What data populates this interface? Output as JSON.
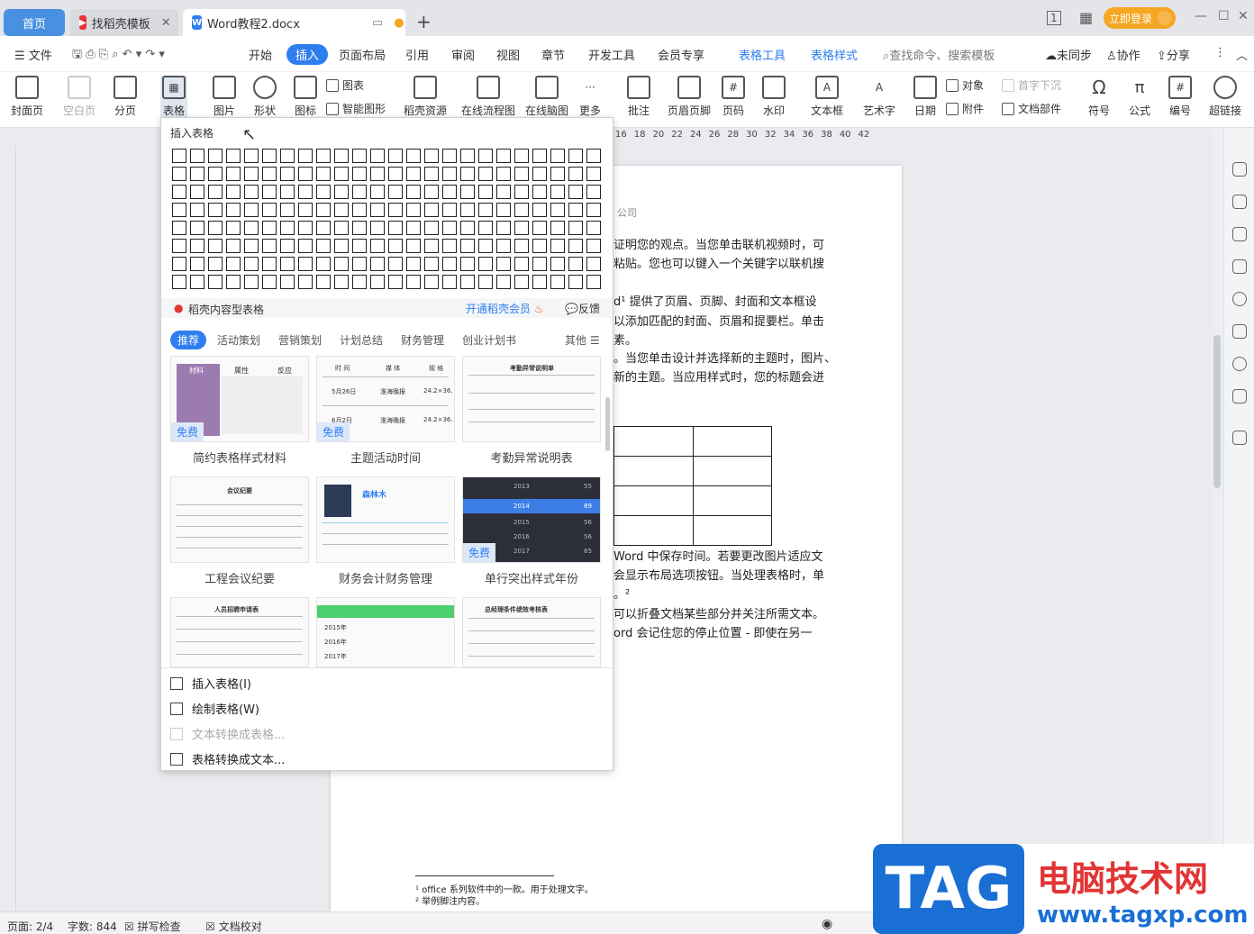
{
  "tabs": {
    "home": "首页",
    "template": "找稻壳模板",
    "document": "Word教程2.docx",
    "add": "+"
  },
  "titlebar": {
    "login": "立即登录"
  },
  "menu": {
    "file": "文件",
    "items": [
      "开始",
      "插入",
      "页面布局",
      "引用",
      "审阅",
      "视图",
      "章节",
      "开发工具",
      "会员专享"
    ],
    "context": [
      "表格工具",
      "表格样式"
    ],
    "search": "查找命令、搜索模板",
    "sync": "未同步",
    "collab": "协作",
    "share": "分享"
  },
  "ribbon": {
    "cover": "封面页",
    "blank": "空白页",
    "pagebreak": "分页",
    "table": "表格",
    "picture": "图片",
    "shape": "形状",
    "icon": "图标",
    "chart": "图表",
    "smartart": "智能图形",
    "docres": "稻壳资源",
    "flow": "在线流程图",
    "mind": "在线脑图",
    "more": "更多",
    "comment": "批注",
    "headerfooter": "页眉页脚",
    "pagenum": "页码",
    "watermark": "水印",
    "textbox": "文本框",
    "wordart": "艺术字",
    "date": "日期",
    "object": "对象",
    "attach": "附件",
    "dropcap": "首字下沉",
    "docpart": "文档部件",
    "symbol": "符号",
    "formula": "公式",
    "numbering": "编号",
    "hyperlink": "超链接"
  },
  "ruler": {
    "ticks": [
      "16",
      "18",
      "20",
      "22",
      "24",
      "26",
      "28",
      "30",
      "32",
      "34",
      "36",
      "38",
      "40",
      "42"
    ]
  },
  "document": {
    "header_frag": "公司",
    "lines": [
      "证明您的观点。当您单击联机视频时，可",
      "粘贴。您也可以键入一个关键字以联机搜",
      "d¹ 提供了页眉、页脚、封面和文本框设",
      "以添加匹配的封面、页眉和提要栏。单击",
      "素。",
      "。当您单击设计并选择新的主题时，图片、",
      "新的主题。当应用样式时，您的标题会进"
    ],
    "lines2": [
      "Word 中保存时间。若要更改图片适应文",
      "会显示布局选项按钮。当处理表格时，单",
      "。²",
      "可以折叠文档某些部分并关注所需文本。",
      "ord 会记住您的停止位置 - 即使在另一"
    ],
    "footnotes": [
      "office 系列软件中的一款。用于处理文字。",
      "举例脚注内容。"
    ]
  },
  "dropdown": {
    "title": "插入表格",
    "daoke": "稻壳内容型表格",
    "vip": "开通稻壳会员",
    "feedback": "反馈",
    "categories": [
      "推荐",
      "活动策划",
      "营销策划",
      "计划总结",
      "财务管理",
      "创业计划书"
    ],
    "other": "其他",
    "templates": [
      {
        "name": "简约表格样式材料",
        "free": "免费"
      },
      {
        "name": "主题活动时间",
        "free": "免费"
      },
      {
        "name": "考勤异常说明表",
        "free": ""
      },
      {
        "name": "工程会议纪要",
        "free": ""
      },
      {
        "name": "财务会计财务管理",
        "free": ""
      },
      {
        "name": "单行突出样式年份",
        "free": "免费"
      }
    ],
    "thumbtext": {
      "t1": [
        "材料",
        "属性",
        "反应"
      ],
      "t2": [
        "时 间",
        "媒 体",
        "规 格",
        "5月26日",
        "淮海晚报",
        "24.2×36.",
        "6月2日",
        "淮海晚报",
        "24.2×36."
      ],
      "t3": "考勤异常说明单",
      "t4": "会议纪要",
      "t5": "森林木",
      "t6": [
        "2013",
        "2014",
        "2015",
        "2016",
        "2017"
      ],
      "t6v": [
        "55",
        "89",
        "56",
        "56",
        "65"
      ],
      "t7": "人员招聘申请表",
      "t8": [
        "2015年",
        "2016年",
        "2017年"
      ],
      "t9": "总经理条件绩效考核表"
    },
    "menu": [
      {
        "label": "插入表格(I)",
        "enabled": true
      },
      {
        "label": "绘制表格(W)",
        "enabled": true
      },
      {
        "label": "文本转换成表格...",
        "enabled": false
      },
      {
        "label": "表格转换成文本...",
        "enabled": true
      }
    ]
  },
  "status": {
    "page": "页面: 2/4",
    "words": "字数: 844",
    "spell": "拼写检查",
    "proof": "文档校对"
  },
  "watermark": {
    "tag": "TAG",
    "title": "电脑技术网",
    "url": "www.tagxp.com"
  },
  "colors": {
    "accent": "#2e7ef0",
    "login": "#f5a623",
    "tag_blue": "#1a6fd4",
    "tag_red": "#e23434"
  }
}
